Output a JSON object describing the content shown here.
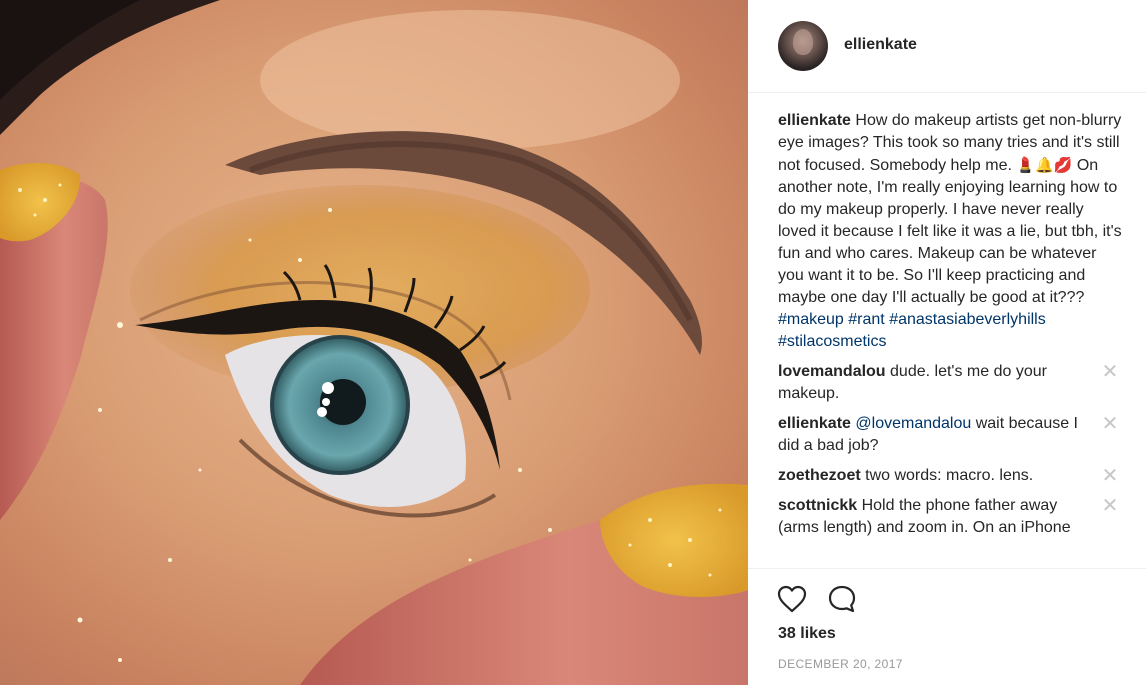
{
  "post": {
    "image_alt": "close-up of a woman's eye with gold glitter eyeshadow and winged eyeliner, gold glitter nails"
  },
  "author": {
    "username": "ellienkate"
  },
  "caption": {
    "username": "ellienkate",
    "text_before_emoji": "How do makeup artists get non-blurry eye images? This took so many tries and it's still not focused. Somebody help me.",
    "emojis": "💄🔔💋",
    "text_after_emoji": "On another note, I'm really enjoying learning how to do my makeup properly. I have never really loved it because I felt like it was a lie, but tbh, it's fun and who cares. Makeup can be whatever you want it to be. So I'll keep practicing and maybe one day I'll actually be good at it???",
    "hashtags": [
      "#makeup",
      "#rant",
      "#anastasiabeverlyhills",
      "#stilacosmetics"
    ]
  },
  "comments": [
    {
      "username": "lovemandalou",
      "mention": "",
      "text": "dude. let's me do your makeup."
    },
    {
      "username": "ellienkate",
      "mention": "@lovemandalou",
      "text": "wait because I did a bad job?"
    },
    {
      "username": "zoethezoet",
      "mention": "",
      "text": "two words: macro. lens."
    },
    {
      "username": "scottnickk",
      "mention": "",
      "text": "Hold the phone father away (arms length) and zoom in. On an iPhone"
    }
  ],
  "delete_glyph": "✕",
  "stats": {
    "likes": "38 likes",
    "date": "DECEMBER 20, 2017"
  },
  "icons": {
    "like": "heart-icon",
    "comment": "speech-bubble-icon",
    "delete": "close-icon"
  },
  "colors": {
    "link": "#003569",
    "muted": "#999999",
    "text": "#262626",
    "divider": "#efefef"
  }
}
